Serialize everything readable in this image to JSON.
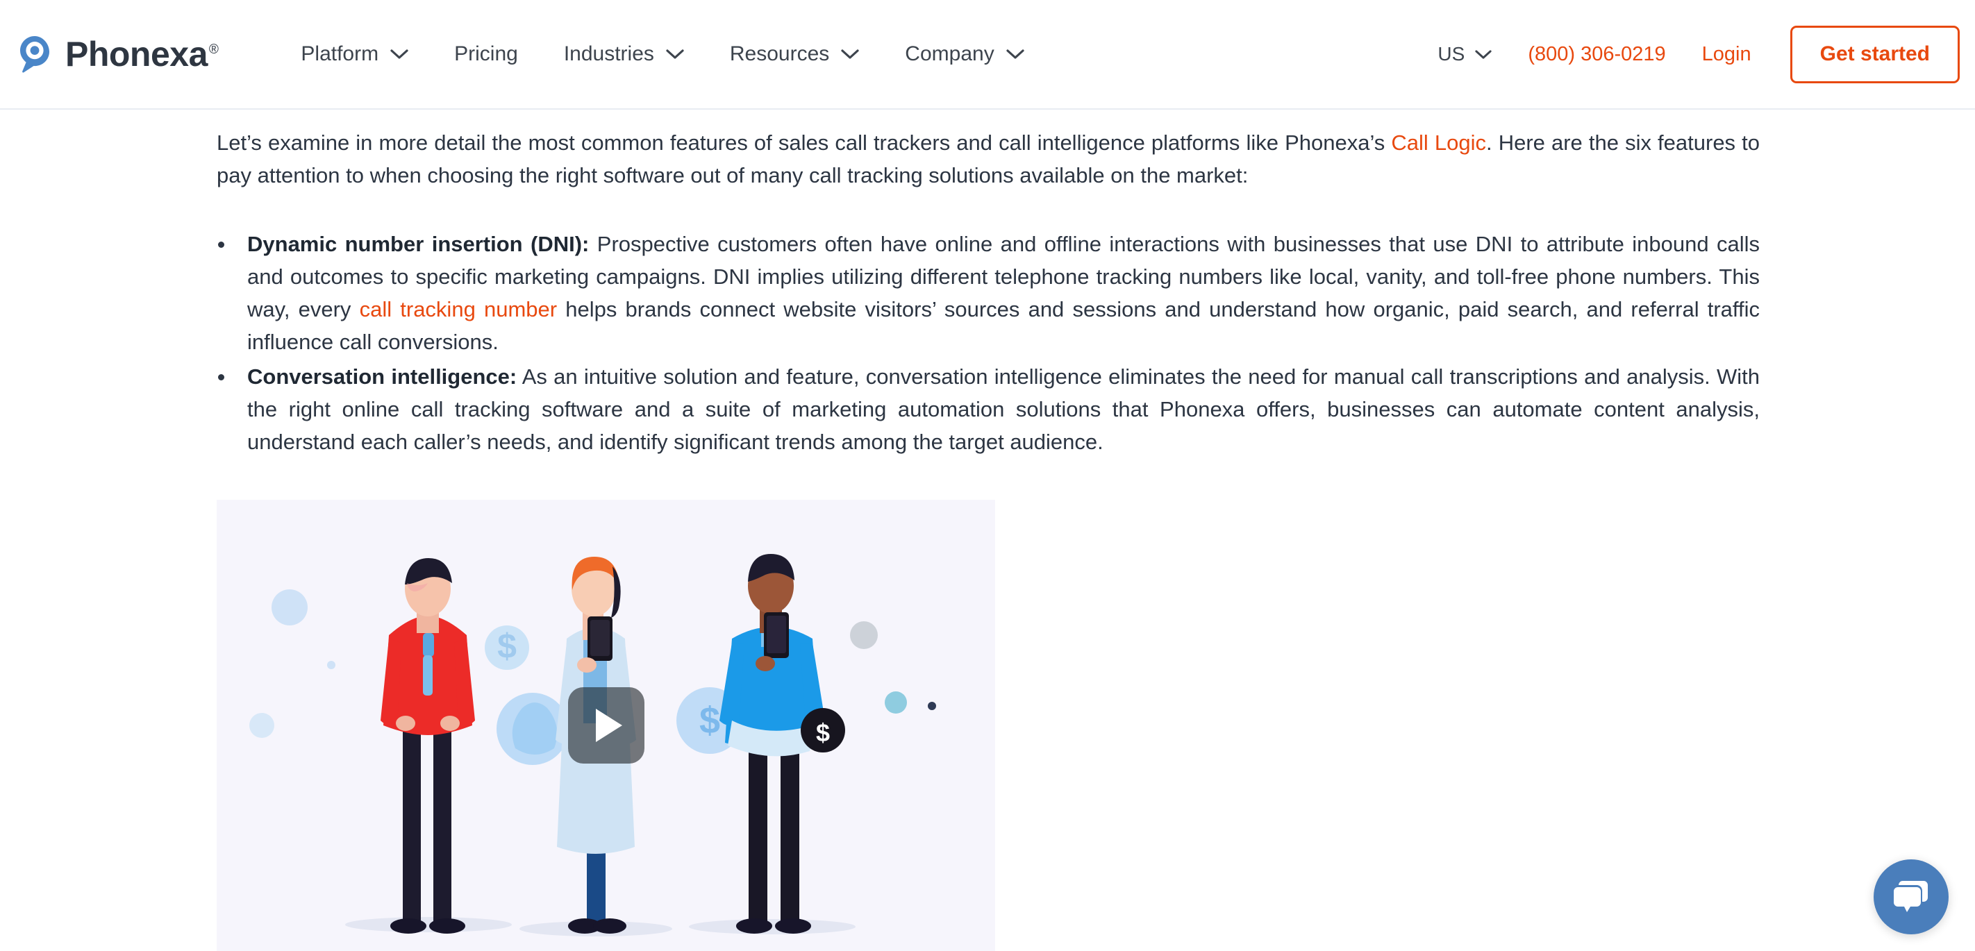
{
  "header": {
    "logo": {
      "text": "Phonexa",
      "registered_mark": "®",
      "icon": "location-pin-chat-icon"
    },
    "nav": [
      {
        "label": "Platform",
        "has_dropdown": true
      },
      {
        "label": "Pricing",
        "has_dropdown": false
      },
      {
        "label": "Industries",
        "has_dropdown": true
      },
      {
        "label": "Resources",
        "has_dropdown": true
      },
      {
        "label": "Company",
        "has_dropdown": true
      }
    ],
    "region": {
      "label": "US",
      "has_dropdown": true
    },
    "phone": "(800) 306-0219",
    "login": "Login",
    "cta": "Get started",
    "accent_color": "#e8490f",
    "text_color": "#3d444d"
  },
  "article": {
    "intro": {
      "before_link": "Let’s examine in more detail the most common features of sales call trackers and call intelligence platforms like Phonexa’s ",
      "link": "Call Logic",
      "after_link": ". Here are the six features to pay attention to when choosing the right software out of many call tracking solutions available on the market:"
    },
    "features": [
      {
        "lead": "Dynamic number insertion (DNI):",
        "body_before_link": " Prospective customers often have online and offline interactions with businesses that use DNI to attribute inbound calls and outcomes to specific marketing campaigns. DNI implies utilizing different telephone tracking numbers like local, vanity, and toll-free phone numbers. This way, every ",
        "link": "call tracking number",
        "body_after_link": " helps brands connect website visitors’ sources and sessions and understand how organic, paid search, and referral traffic influence call conversions."
      },
      {
        "lead": "Conversation intelligence:",
        "body_before_link": " As an intuitive solution and feature, conversation intelligence eliminates the need for manual call transcriptions and analysis. With the right online call tracking software and a suite of marketing automation solutions that Phonexa offers, businesses can automate content analysis, understand each caller’s needs, and identify significant trends among the target audience.",
        "link": "",
        "body_after_link": ""
      }
    ]
  },
  "video": {
    "alt": "Illustration of three people holding smartphones",
    "play_icon": "play-triangle-icon",
    "background_color": "#f6f5fc"
  },
  "chat": {
    "icon": "chat-bubbles-icon",
    "color": "#4a7ebb"
  }
}
